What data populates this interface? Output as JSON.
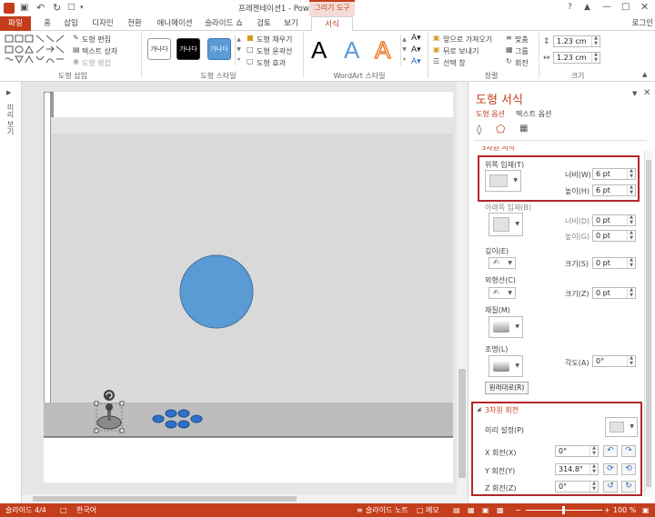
{
  "window": {
    "title": "프레젠테이션1 - PowerPoint",
    "context_tab": "그리기 도구",
    "signin": "로그인"
  },
  "ribbon_tabs": [
    "파일",
    "홈",
    "삽입",
    "디자인",
    "전환",
    "애니메이션",
    "슬라이드 쇼",
    "검토",
    "보기",
    "서식"
  ],
  "ribbon": {
    "insert_shapes": {
      "edit_shape": "도형 편집",
      "text_box": "텍스트 상자",
      "merge_shapes": "도형 병합",
      "label": "도형 삽입"
    },
    "shape_styles": {
      "samples": [
        "가나다",
        "가나다",
        "가나다"
      ],
      "fill": "도형 채우기",
      "outline": "도형 윤곽선",
      "effects": "도형 효과",
      "label": "도형 스타일"
    },
    "wordart": {
      "sample": "A",
      "label": "WordArt 스타일"
    },
    "arrange": {
      "bring_forward": "앞으로 가져오기",
      "send_backward": "뒤로 보내기",
      "selection_pane": "선택 창",
      "align": "맞춤",
      "group": "그룹",
      "rotate": "회전",
      "label": "정렬"
    },
    "size": {
      "height": "1.23 cm",
      "width": "1.23 cm",
      "label": "크기"
    }
  },
  "left_rail": {
    "label": "미리 보기"
  },
  "pane": {
    "title": "도형 서식",
    "tabs": {
      "shape_options": "도형 옵션",
      "text_options": "텍스트 옵션"
    },
    "section_3d_format": "3차원 서식",
    "top_bevel": {
      "label": "위쪽 입체(T)",
      "width_label": "너비(W)",
      "width": "6 pt",
      "height_label": "높이(H)",
      "height": "6 pt"
    },
    "bottom_bevel": {
      "label": "아래쪽 입체(B)",
      "width_label": "너비(D)",
      "width": "0 pt",
      "height_label": "높이(G)",
      "height": "0 pt"
    },
    "depth": {
      "label": "깊이(E)",
      "size_label": "크기(S)",
      "size": "0 pt"
    },
    "contour": {
      "label": "외형선(C)",
      "size_label": "크기(Z)",
      "size": "0 pt"
    },
    "material": {
      "label": "재질(M)"
    },
    "lighting": {
      "label": "조명(L)",
      "angle_label": "각도(A)",
      "angle": "0°"
    },
    "reset_button": "원래대로(R)",
    "section_3d_rotation": "3차원 회전",
    "presets": {
      "label": "미리 설정(P)"
    },
    "x_rotation": {
      "label": "X 회전(X)",
      "value": "0°"
    },
    "y_rotation": {
      "label": "Y 회전(Y)",
      "value": "314.8°"
    },
    "z_rotation": {
      "label": "Z 회전(Z)",
      "value": "0°"
    }
  },
  "status": {
    "slide": "슬라이드 4/4",
    "language": "한국어",
    "notes": "슬라이드 노트",
    "comments": "메모",
    "zoom": "100 %"
  },
  "colors": {
    "accent": "#c43e1c",
    "circle": "#5b9bd5",
    "buttons": "#2e6fc9",
    "highlight": "#b3262b"
  }
}
